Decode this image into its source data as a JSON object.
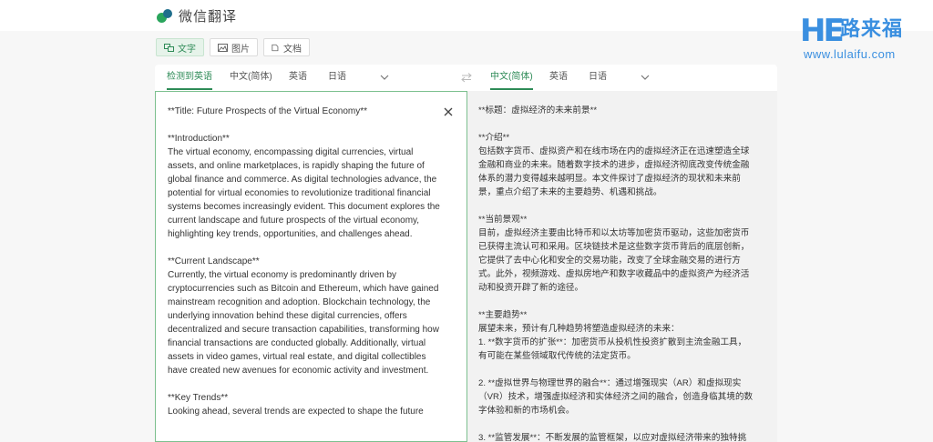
{
  "app": {
    "name": "微信翻译"
  },
  "watermark": {
    "he": "HE",
    "cn": "路来福",
    "url": "www.lulaifu.com"
  },
  "modes": [
    {
      "label": "文字",
      "icon": "text-translate-icon",
      "active": true
    },
    {
      "label": "图片",
      "icon": "image-icon",
      "active": false
    },
    {
      "label": "文档",
      "icon": "document-icon",
      "active": false
    }
  ],
  "source_langs": {
    "detected": "检测到英语",
    "options": [
      "中文(简体)",
      "英语",
      "日语"
    ]
  },
  "swap_icon": "swap-arrows-icon",
  "target_langs": {
    "options": [
      "中文(简体)",
      "英语",
      "日语"
    ]
  },
  "source_text": "**Title: Future Prospects of the Virtual Economy**\n\n**Introduction**\nThe virtual economy, encompassing digital currencies, virtual assets, and online marketplaces, is rapidly shaping the future of global finance and commerce. As digital technologies advance, the potential for virtual economies to revolutionize traditional financial systems becomes increasingly evident. This document explores the current landscape and future prospects of the virtual economy, highlighting key trends, opportunities, and challenges ahead.\n\n**Current Landscape**\nCurrently, the virtual economy is predominantly driven by cryptocurrencies such as Bitcoin and Ethereum, which have gained mainstream recognition and adoption. Blockchain technology, the underlying innovation behind these digital currencies, offers decentralized and secure transaction capabilities, transforming how financial transactions are conducted globally. Additionally, virtual assets in video games, virtual real estate, and digital collectibles have created new avenues for economic activity and investment.\n\n**Key Trends**\nLooking ahead, several trends are expected to shape the future",
  "target_text": "**标题：虚拟经济的未来前景**\n\n**介绍**\n包括数字货币、虚拟资产和在线市场在内的虚拟经济正在迅速塑造全球金融和商业的未来。随着数字技术的进步，虚拟经济彻底改变传统金融体系的潜力变得越来越明显。本文件探讨了虚拟经济的现状和未来前景，重点介绍了未来的主要趋势、机遇和挑战。\n\n**当前景观**\n目前，虚拟经济主要由比特币和以太坊等加密货币驱动，这些加密货币已获得主流认可和采用。区块链技术是这些数字货币背后的底层创新，它提供了去中心化和安全的交易功能，改变了全球金融交易的进行方式。此外，视频游戏、虚拟房地产和数字收藏品中的虚拟资产为经济活动和投资开辟了新的途径。\n\n**主要趋势**\n展望未来，预计有几种趋势将塑造虚拟经济的未来：\n1. **数字货币的扩张**：加密货币从投机性投资扩散到主流金融工具，有可能在某些领域取代传统的法定货币。\n\n2. **虚拟世界与物理世界的融合**：通过增强现实（AR）和虚拟现实（VR）技术，增强虚拟经济和实体经济之间的融合，创造身临其境的数字体验和新的市场机会。\n\n3. **监管发展**：不断发展的监管框架，以应对虚拟经济带来的独特挑"
}
